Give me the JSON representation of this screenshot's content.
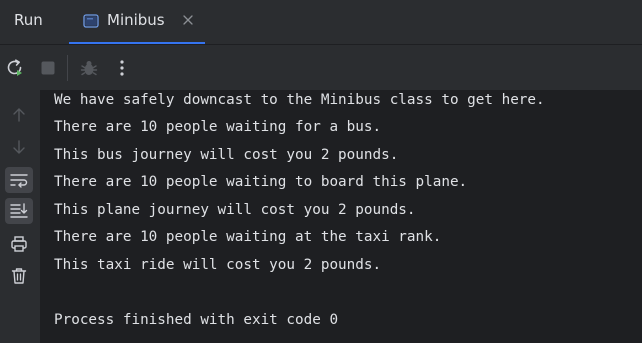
{
  "header": {
    "title": "Run",
    "tab": {
      "label": "Minibus",
      "icon": "console-icon",
      "close_icon": "close-icon"
    }
  },
  "toolbar": {
    "rerun_icon": "rerun-icon",
    "stop_icon": "stop-icon",
    "debug_icon": "bug-icon",
    "more_icon": "more-vertical-icon"
  },
  "gutter": {
    "up_icon": "arrow-up-icon",
    "down_icon": "arrow-down-icon",
    "wrap_icon": "soft-wrap-icon",
    "scroll_end_icon": "scroll-to-end-icon",
    "print_icon": "print-icon",
    "clear_icon": "trash-icon"
  },
  "console": {
    "lines": [
      "We have safely downcast to the Minibus class to get here.",
      "There are 10 people waiting for a bus.",
      "This bus journey will cost you 2 pounds.",
      "There are 10 people waiting to board this plane.",
      "This plane journey will cost you 2 pounds.",
      "There are 10 people waiting at the taxi rank.",
      "This taxi ride will cost you 2 pounds.",
      "",
      "Process finished with exit code 0"
    ]
  },
  "colors": {
    "background": "#2b2d30",
    "console_bg": "#1e1f22",
    "text": "#dfe1e5",
    "accent": "#3574f0",
    "rerun_green": "#5fb865"
  }
}
